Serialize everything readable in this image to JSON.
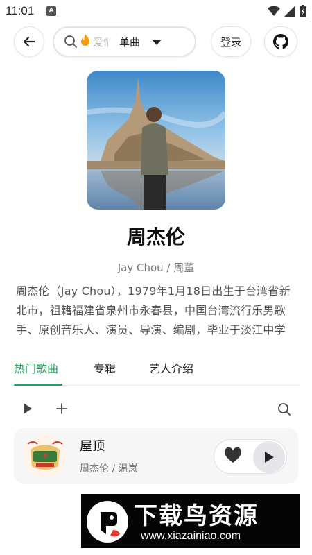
{
  "status_bar": {
    "time": "11:01",
    "app_icon_letter": "A"
  },
  "header": {
    "search_placeholder": "爱情",
    "search_type": "单曲",
    "login_label": "登录"
  },
  "artist": {
    "name": "周杰伦",
    "alias": "Jay Chou / 周董",
    "bio": "周杰伦（Jay Chou），1979年1月18日出生于台湾省新北市，祖籍福建省泉州市永春县，中国台湾流行乐男歌手、原创音乐人、演员、导演、编剧，毕业于淡江中学"
  },
  "tabs": [
    {
      "label": "热门歌曲",
      "active": true
    },
    {
      "label": "专辑",
      "active": false
    },
    {
      "label": "艺人介绍",
      "active": false
    }
  ],
  "songs": [
    {
      "title": "屋顶",
      "artist": "周杰伦 / 温岚"
    }
  ],
  "watermark": {
    "text": "下载鸟资源",
    "url": "www.xiazainiao.com"
  },
  "colors": {
    "accent": "#1aa35a",
    "text": "#222222",
    "muted": "#777777"
  },
  "icons": [
    "arrow-left-icon",
    "search-icon",
    "fire-icon",
    "caret-down-icon",
    "github-icon",
    "play-icon",
    "plus-icon",
    "heart-icon",
    "wifi-icon",
    "signal-icon",
    "battery-icon"
  ]
}
